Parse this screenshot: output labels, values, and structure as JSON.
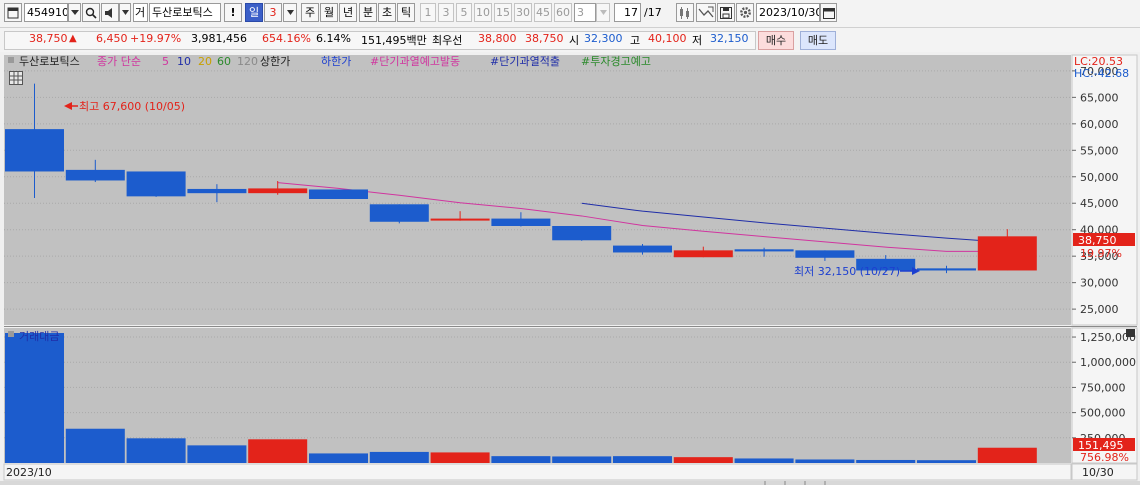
{
  "toolbar": {
    "code": "454910",
    "market_tag": "거",
    "stock_name": "두산로보틱스",
    "period_labels": [
      "일",
      "3",
      "주",
      "월",
      "년",
      "분",
      "초",
      "틱"
    ],
    "interval_buttons": [
      "1",
      "3",
      "5",
      "10",
      "15",
      "30",
      "45",
      "60"
    ],
    "interval_value": "3",
    "count": "17",
    "count_total": "/17",
    "date": "2023/10/30",
    "icons": [
      "window-icon",
      "search-icon",
      "sound-icon",
      "alert-icon",
      "candle-settings-icon",
      "trend-icon",
      "save-icon",
      "gear-icon",
      "calendar-icon"
    ]
  },
  "info": {
    "price": "38,750",
    "arrow": "▲",
    "change": "6,450",
    "change_pct": "+19.97%",
    "volume": "3,981,456",
    "volume_ratio": "654.16%",
    "turnover": "6.14%",
    "trade_value": "151,495백만",
    "priority_label": "최우선",
    "ask": "38,800",
    "bid": "38,750",
    "open_label": "시",
    "open": "32,300",
    "high_label": "고",
    "high": "40,100",
    "low_label": "저",
    "low": "32,150",
    "buy_label": "매수",
    "sell_label": "매도"
  },
  "legend": {
    "name": "두산로보틱스",
    "ma_label": "종가 단순",
    "ma_periods": [
      "5",
      "10",
      "20",
      "60",
      "120"
    ],
    "upper_limit": "상한가",
    "lower_limit": "하한가",
    "alert1": "#단기과열예고발동",
    "alert2": "#단기과열적출",
    "alert3": "#투자경고예고",
    "lc": "LC:20.53",
    "hc": "HC:-42.68",
    "volume_panel_label": "거래대금",
    "bottom_left_date": "2023/10",
    "bottom_right_date": "10/30",
    "high_annotation": "최고 67,600 (10/05)",
    "low_annotation": "최저 32,150 (10/27)",
    "price_tag": "38,750",
    "pct_tag": "19.97%",
    "vol_tag": "151,495",
    "vol_pct_tag": "756.98%"
  },
  "colors": {
    "up": "#e3231a",
    "down": "#1c5ccd",
    "ma5": "#d0359f",
    "ma10": "#1f2da8",
    "ma20": "#c8a000",
    "ma60": "#2b8a2b",
    "ma120": "#8a8a8a",
    "plot_bg": "#c1c1c1"
  },
  "chart_data": [
    {
      "type": "candlestick",
      "y_axis_ticks": [
        25000,
        30000,
        35000,
        40000,
        45000,
        50000,
        55000,
        60000,
        65000,
        70000
      ],
      "y_axis_labels": [
        "25,000",
        "30,000",
        "35,000",
        "40,000",
        "45,000",
        "50,000",
        "55,000",
        "60,000",
        "65,000",
        "70,000"
      ],
      "ylim": [
        22000,
        73000
      ],
      "candles": [
        {
          "o": 59000,
          "h": 67600,
          "l": 46000,
          "c": 51000
        },
        {
          "o": 51300,
          "h": 53200,
          "l": 49000,
          "c": 49300
        },
        {
          "o": 51000,
          "h": 51000,
          "l": 46200,
          "c": 46300
        },
        {
          "o": 47700,
          "h": 48600,
          "l": 45200,
          "c": 46900
        },
        {
          "o": 46900,
          "h": 49200,
          "l": 46600,
          "c": 47800
        },
        {
          "o": 47600,
          "h": 47600,
          "l": 45800,
          "c": 45800
        },
        {
          "o": 44800,
          "h": 44800,
          "l": 41200,
          "c": 41500
        },
        {
          "o": 42000,
          "h": 43500,
          "l": 41700,
          "c": 42100
        },
        {
          "o": 42100,
          "h": 43300,
          "l": 40600,
          "c": 40700
        },
        {
          "o": 40700,
          "h": 40700,
          "l": 37900,
          "c": 38000
        },
        {
          "o": 37000,
          "h": 37300,
          "l": 35300,
          "c": 35700
        },
        {
          "o": 34800,
          "h": 36800,
          "l": 34800,
          "c": 36100
        },
        {
          "o": 36300,
          "h": 36600,
          "l": 34900,
          "c": 35900
        },
        {
          "o": 36100,
          "h": 36100,
          "l": 34100,
          "c": 34700
        },
        {
          "o": 34500,
          "h": 35200,
          "l": 32150,
          "c": 32300
        },
        {
          "o": 32700,
          "h": 33200,
          "l": 31800,
          "c": 32300
        },
        {
          "o": 32300,
          "h": 40100,
          "l": 32300,
          "c": 38750
        }
      ],
      "ma5": [
        null,
        null,
        null,
        null,
        48900,
        47800,
        46500,
        45100,
        44000,
        42600,
        40800,
        39700,
        38700,
        37700,
        36700,
        35900,
        35900
      ],
      "ma10": [
        null,
        null,
        null,
        null,
        null,
        null,
        null,
        null,
        null,
        45000,
        43500,
        42400,
        41300,
        40300,
        39300,
        38400,
        37600
      ]
    },
    {
      "type": "bar",
      "name": "거래대금",
      "y_axis_ticks": [
        250000,
        500000,
        750000,
        1000000,
        1250000
      ],
      "y_axis_labels": [
        "250,000",
        "500,000",
        "750,000",
        "1,000,000",
        "1,250,000"
      ],
      "ylim": [
        0,
        1300000
      ],
      "values": [
        1290000,
        340000,
        245000,
        175000,
        235000,
        95000,
        110000,
        105000,
        68000,
        65000,
        68000,
        58000,
        45000,
        35000,
        30000,
        28000,
        151495
      ]
    }
  ]
}
